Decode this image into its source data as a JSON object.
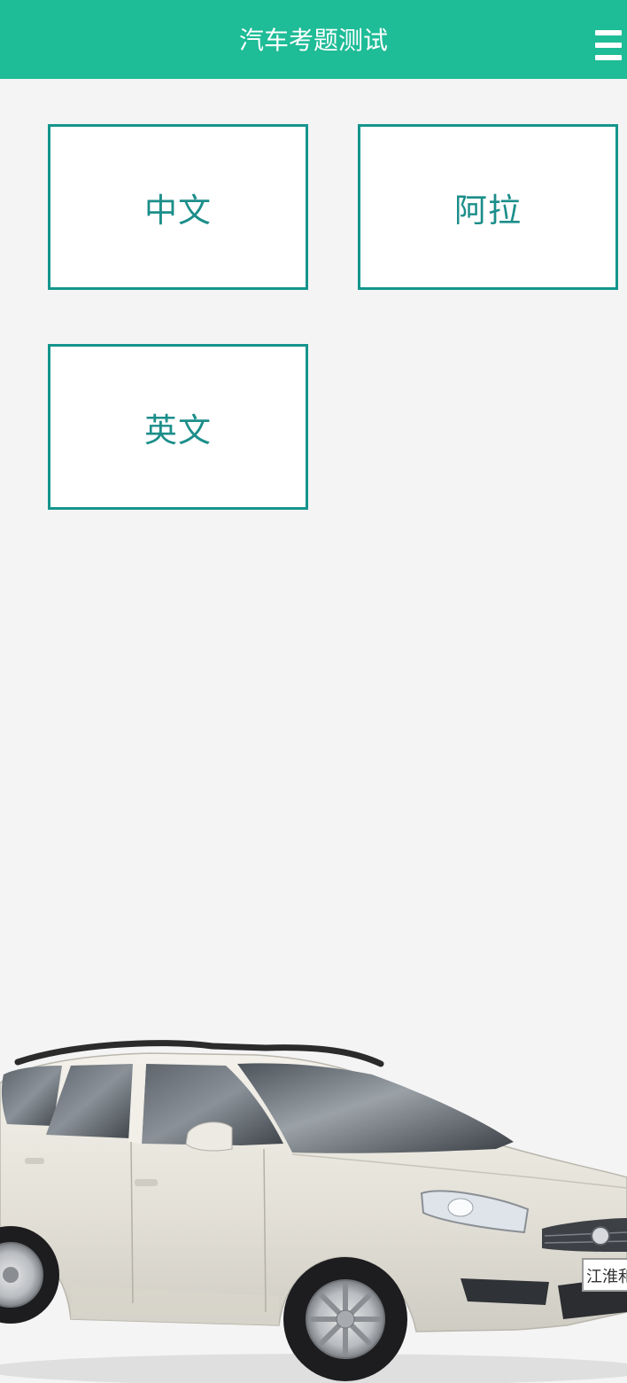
{
  "header": {
    "title": "汽车考题测试",
    "menu_icon": "hamburger-menu-icon"
  },
  "languages": [
    {
      "label": "中文"
    },
    {
      "label": "阿拉"
    },
    {
      "label": "英文"
    }
  ],
  "banner": {
    "plate_text": "江淮和悦",
    "image": "car-image"
  },
  "colors": {
    "header_bg": "#1ebc97",
    "box_border": "#15958d",
    "label_text": "#1c8e8a",
    "page_bg": "#f4f4f4"
  }
}
